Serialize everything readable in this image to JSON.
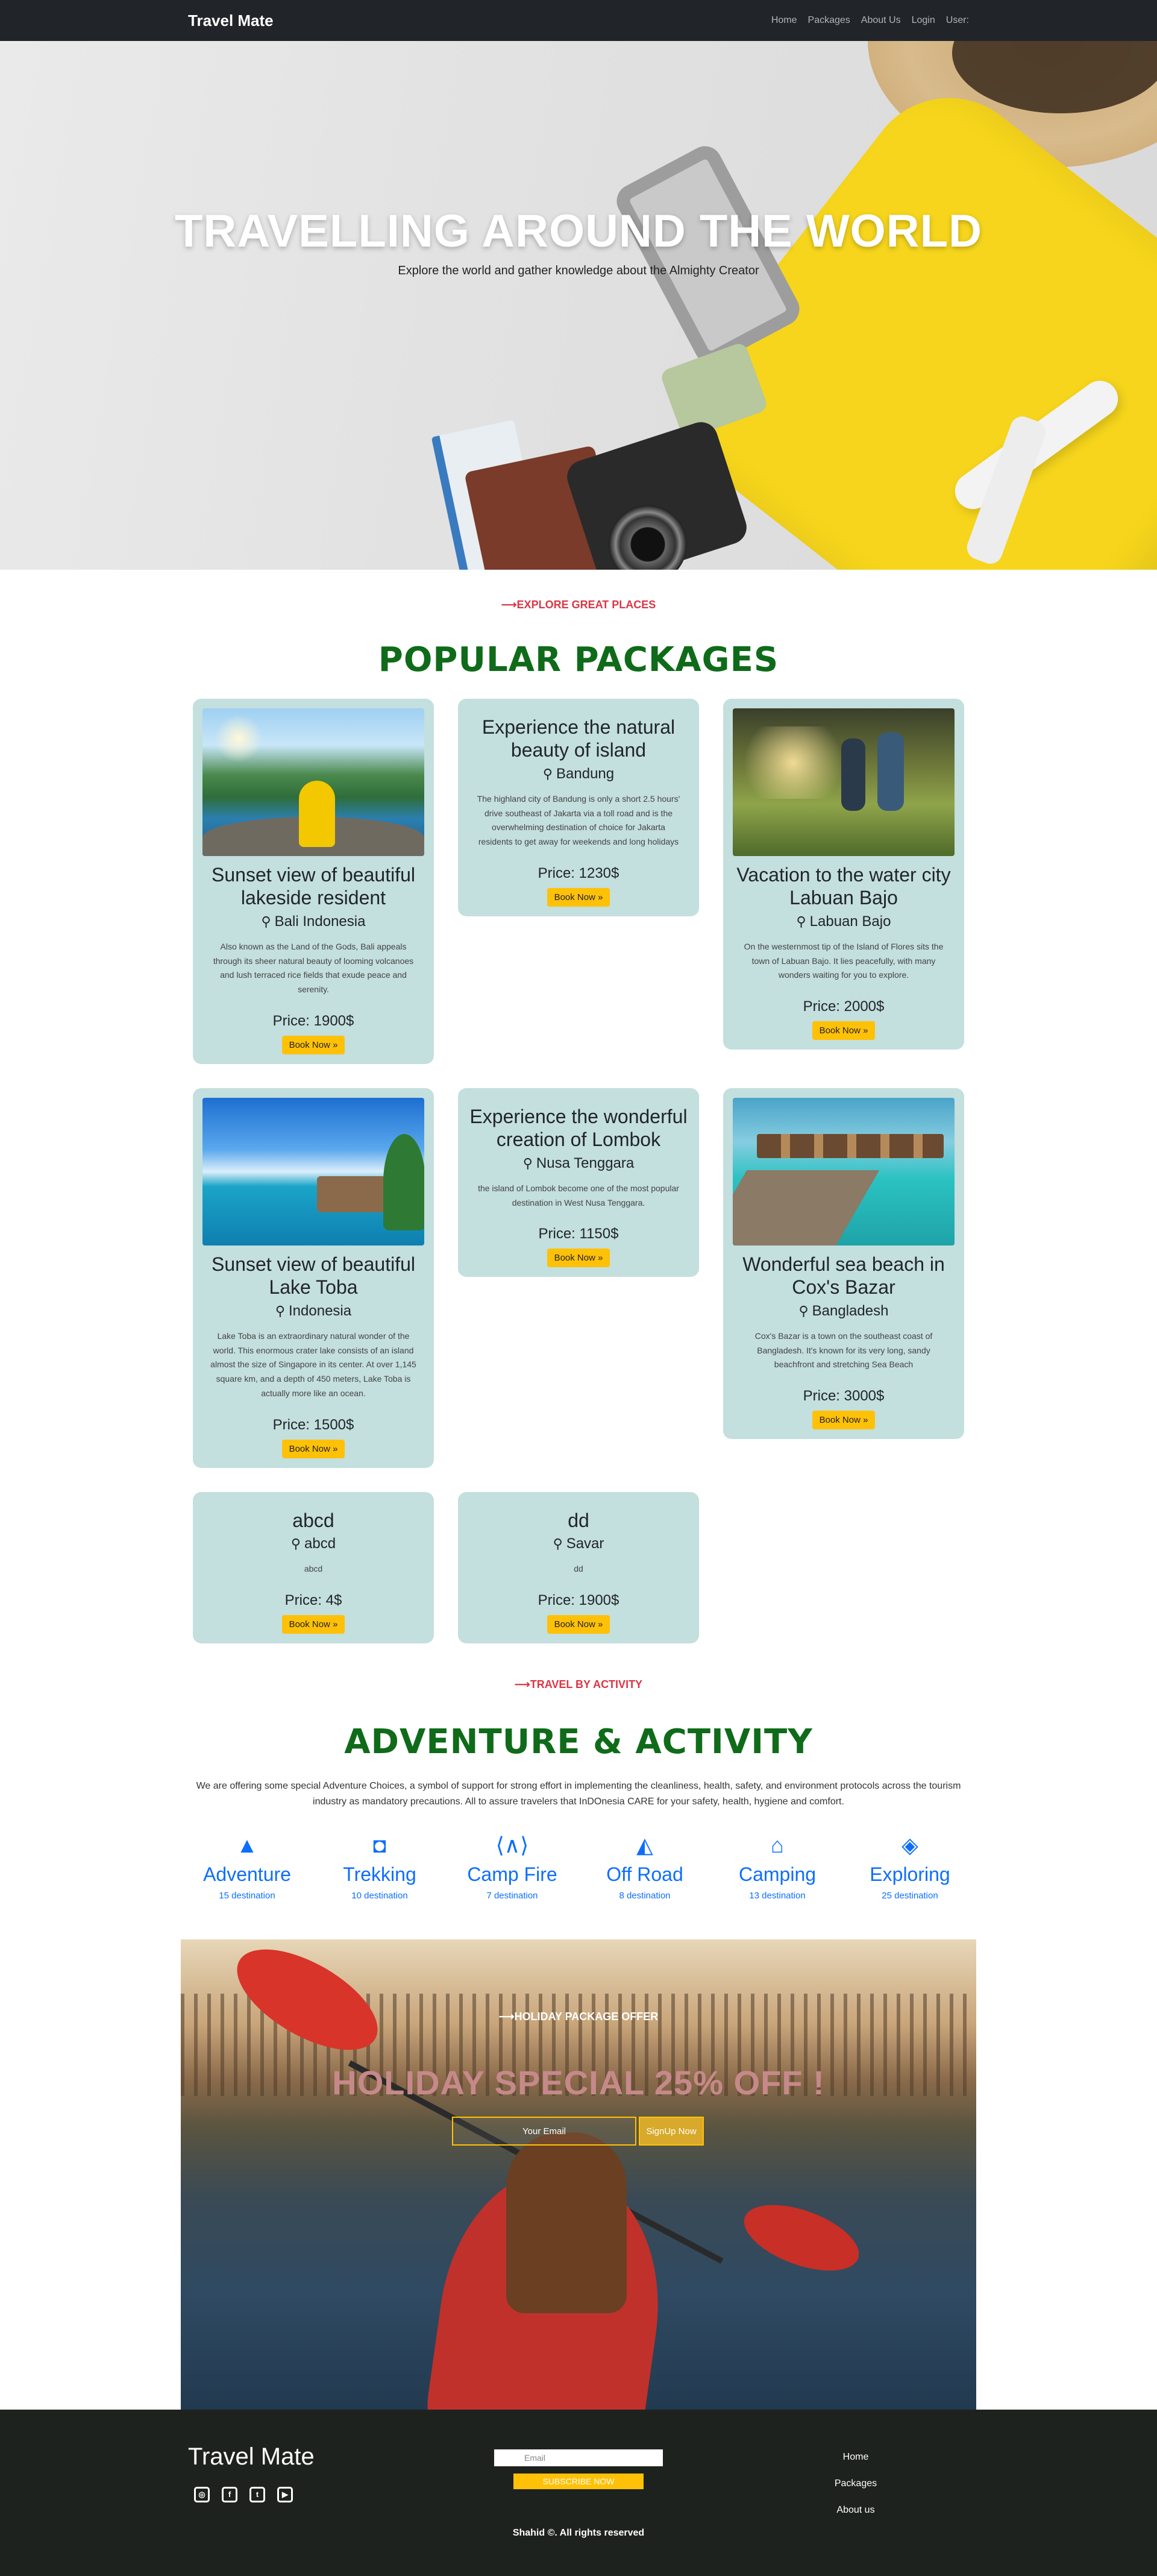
{
  "nav": {
    "brand": "Travel Mate",
    "links": [
      "Home",
      "Packages",
      "About Us",
      "Login",
      "User:"
    ]
  },
  "hero": {
    "title": "TRAVELLING AROUND THE WORLD",
    "subtitle": "Explore the world and gather knowledge about the Almighty Creator"
  },
  "packages": {
    "kicker": "⟶EXPLORE GREAT PLACES",
    "heading": "POPULAR PACKAGES",
    "price_prefix": "Price: ",
    "book_label": "Book Now »",
    "cards": [
      {
        "title": "Sunset view of beautiful lakeside resident",
        "location": "Bali Indonesia",
        "description": "Also known as the Land of the Gods, Bali appeals through its sheer natural beauty of looming volcanoes and lush terraced rice fields that exude peace and serenity.",
        "price": "1900$",
        "image": "bali"
      },
      {
        "title": "Experience the natural beauty of island",
        "location": "Bandung",
        "description": "The highland city of Bandung is only a short 2.5 hours' drive southeast of Jakarta via a toll road and is the overwhelming destination of choice for Jakarta residents to get away for weekends and long holidays",
        "price": "1230$",
        "image": ""
      },
      {
        "title": "Vacation to the water city Labuan Bajo",
        "location": "Labuan Bajo",
        "description": "On the westernmost tip of the Island of Flores sits the town of Labuan Bajo. It lies peacefully, with many wonders waiting for you to explore.",
        "price": "2000$",
        "image": "labuan"
      },
      {
        "title": "Sunset view of beautiful Lake Toba",
        "location": "Indonesia",
        "description": "Lake Toba is an extraordinary natural wonder of the world. This enormous crater lake consists of an island almost the size of Singapore in its center. At over 1,145 square km, and a depth of 450 meters, Lake Toba is actually more like an ocean.",
        "price": "1500$",
        "image": "toba"
      },
      {
        "title": "Experience the wonderful creation of Lombok",
        "location": "Nusa Tenggara",
        "description": "the island of Lombok become one of the most popular destination in West Nusa Tenggara.",
        "price": "1150$",
        "image": ""
      },
      {
        "title": "Wonderful sea beach in Cox's Bazar",
        "location": "Bangladesh",
        "description": "Cox's Bazar is a town on the southeast coast of Bangladesh. It's known for its very long, sandy beachfront and stretching Sea Beach",
        "price": "3000$",
        "image": "cox"
      },
      {
        "title": "abcd",
        "location": "abcd",
        "description": "abcd",
        "price": "4$",
        "image": ""
      },
      {
        "title": "dd",
        "location": "Savar",
        "description": "dd",
        "price": "1900$",
        "image": ""
      }
    ]
  },
  "activity": {
    "kicker": "⟶TRAVEL BY ACTIVITY",
    "heading": "ADVENTURE & ACTIVITY",
    "description": "We are offering some special Adventure Choices, a symbol of support for strong effort in implementing the cleanliness, health, safety, and environment protocols across the tourism industry as mandatory precautions. All to assure travelers that InDOnesia CARE for your safety, health, hygiene and comfort.",
    "items": [
      {
        "icon": "mountain-icon",
        "glyph": "▲",
        "name": "Adventure",
        "count": "15 destination"
      },
      {
        "icon": "backpack-icon",
        "glyph": "◘",
        "name": "Trekking",
        "count": "10 destination"
      },
      {
        "icon": "campfire-icon",
        "glyph": "⟨∧⟩",
        "name": "Camp Fire",
        "count": "7 destination"
      },
      {
        "icon": "road-icon",
        "glyph": "◭",
        "name": "Off Road",
        "count": "8 destination"
      },
      {
        "icon": "house-icon",
        "glyph": "⌂",
        "name": "Camping",
        "count": "13 destination"
      },
      {
        "icon": "map-icon",
        "glyph": "◈",
        "name": "Exploring",
        "count": "25 destination"
      }
    ]
  },
  "holiday": {
    "kicker": "⟶HOLIDAY PACKAGE OFFER",
    "title": "HOLIDAY SPECIAL 25% OFF !",
    "input_placeholder": "Your Email",
    "button": "SignUp Now"
  },
  "footer": {
    "brand": "Travel Mate",
    "social": [
      "instagram-icon",
      "facebook-icon",
      "twitter-icon",
      "youtube-icon"
    ],
    "email_placeholder": "Email",
    "subscribe": "SUBSCRIBE NOW",
    "links": [
      "Home",
      "Packages",
      "About us"
    ],
    "copyright": "Shahid ©. All rights reserved"
  },
  "colors": {
    "navbar": "#212529",
    "card": "#c3dfde",
    "accent_button": "#ffc107",
    "heading_green": "#0f6b19",
    "kicker_red": "#dc3545",
    "activity_blue": "#0d6efd",
    "footer": "#1e221e"
  }
}
